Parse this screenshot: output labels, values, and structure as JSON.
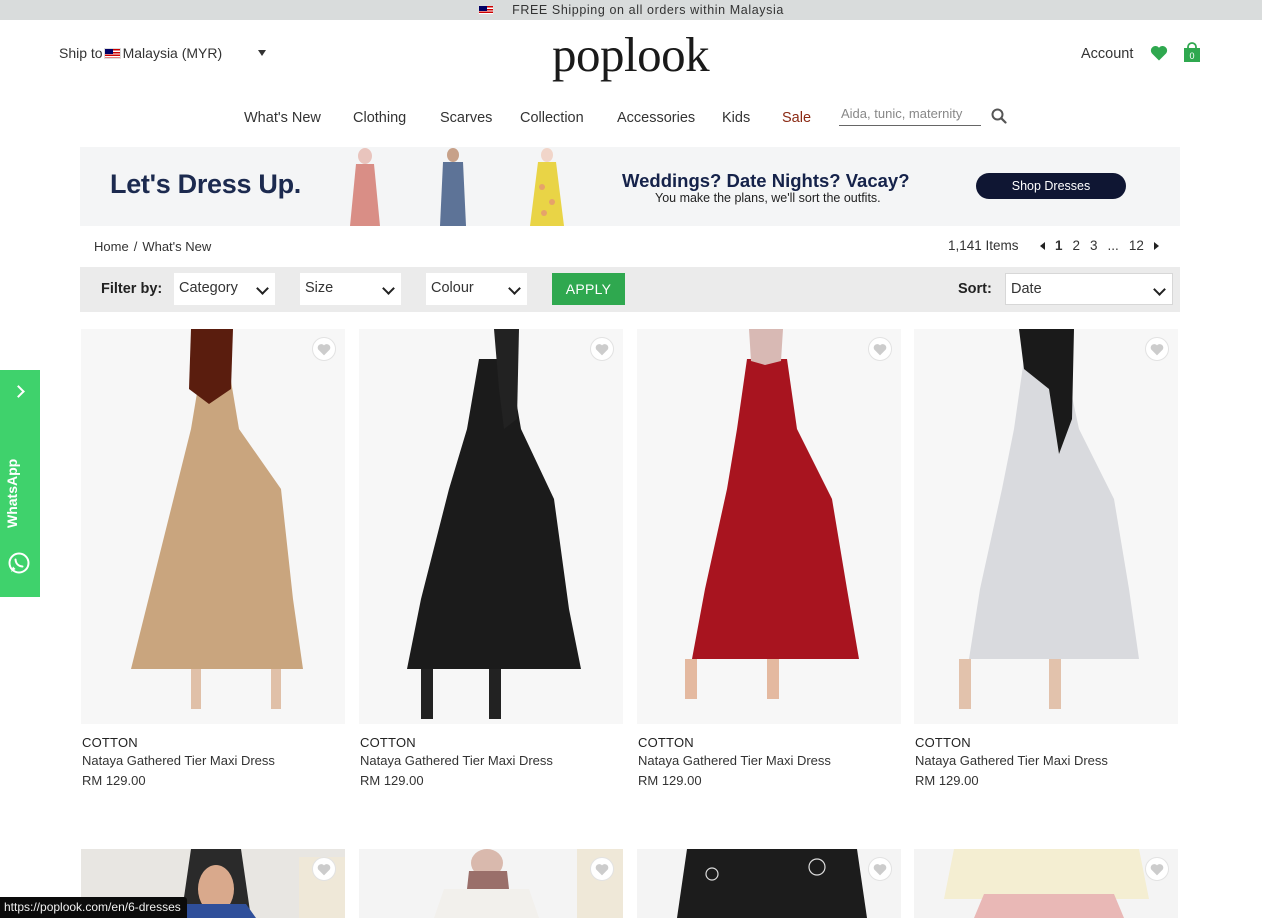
{
  "topbar": {
    "text": "FREE Shipping on all orders within Malaysia"
  },
  "header": {
    "ship_to_label": "Ship to",
    "ship_to_value": "Malaysia (MYR)",
    "logo": "poplook",
    "account": "Account",
    "cart_count": "0"
  },
  "nav": {
    "items": [
      "What's New",
      "Clothing",
      "Scarves",
      "Collection",
      "Accessories",
      "Kids",
      "Sale"
    ],
    "search_placeholder": "Aida, tunic, maternity"
  },
  "banner": {
    "title": "Let's Dress Up.",
    "headline": "Weddings? Date Nights? Vacay?",
    "subline": "You make the plans, we'll sort the outfits.",
    "button": "Shop Dresses"
  },
  "breadcrumb": {
    "home": "Home",
    "sep": "/",
    "current": "What's New"
  },
  "pagination": {
    "items": "1,141 Items",
    "pages": [
      "1",
      "2",
      "3",
      "...",
      "12"
    ]
  },
  "filters": {
    "label": "Filter by:",
    "category": "Category",
    "size": "Size",
    "colour": "Colour",
    "apply": "APPLY",
    "sort_label": "Sort:",
    "sort_value": "Date"
  },
  "products": [
    {
      "brand": "COTTON",
      "name": "Nataya Gathered Tier Maxi Dress",
      "price": "RM 129.00",
      "color": "#c9a57e",
      "scarf": "#5a1d0e"
    },
    {
      "brand": "COTTON",
      "name": "Nataya Gathered Tier Maxi Dress",
      "price": "RM 129.00",
      "color": "#1b1b1b",
      "scarf": "#222222"
    },
    {
      "brand": "COTTON",
      "name": "Nataya Gathered Tier Maxi Dress",
      "price": "RM 129.00",
      "color": "#a8141f",
      "scarf": "#d8b9b4"
    },
    {
      "brand": "COTTON",
      "name": "Nataya Gathered Tier Maxi Dress",
      "price": "RM 129.00",
      "color": "#d9dade",
      "scarf": "#1a1a1a"
    }
  ],
  "whatsapp": {
    "label": "WhatsApp"
  },
  "statusbar": {
    "url": "https://poplook.com/en/6-dresses"
  },
  "colors": {
    "accent_green": "#2fa84f",
    "whatsapp_green": "#3fd26c",
    "banner_navy": "#0f1633",
    "sale": "#8b2a14"
  }
}
